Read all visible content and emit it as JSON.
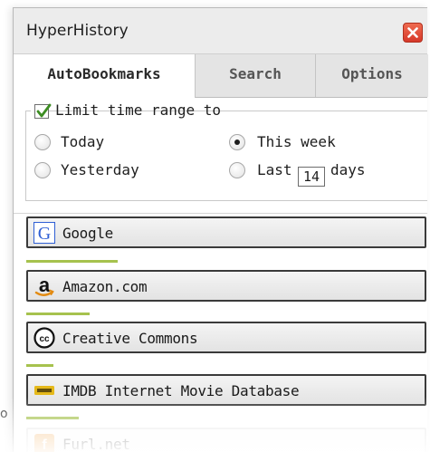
{
  "window": {
    "title": "HyperHistory"
  },
  "tabs": [
    {
      "label": "AutoBookmarks",
      "active": true
    },
    {
      "label": "Search",
      "active": false
    },
    {
      "label": "Options",
      "active": false
    }
  ],
  "filter": {
    "limit_label": "Limit time range to",
    "limit_checked": true,
    "options": {
      "today": {
        "label": "Today",
        "selected": false
      },
      "yesterday": {
        "label": "Yesterday",
        "selected": false
      },
      "this_week": {
        "label": "This week",
        "selected": true
      },
      "last": {
        "label_before": "Last",
        "value": "14",
        "label_after": "days",
        "selected": false
      }
    }
  },
  "bookmarks": [
    {
      "label": "Google",
      "icon": "google-icon",
      "activity": 0.23
    },
    {
      "label": "Amazon.com",
      "icon": "amazon-icon",
      "activity": 0.16
    },
    {
      "label": "Creative Commons",
      "icon": "creative-commons-icon",
      "activity": 0.07
    },
    {
      "label": "IMDB Internet Movie Database",
      "icon": "imdb-icon",
      "activity": 0.13
    },
    {
      "label": "Furl.net",
      "icon": "furl-icon",
      "activity": 0
    }
  ],
  "colors": {
    "activity_bar": "#a6c24e",
    "close_button": "#d9452f",
    "google_blue": "#2f5fd4"
  },
  "edge_text": "o"
}
